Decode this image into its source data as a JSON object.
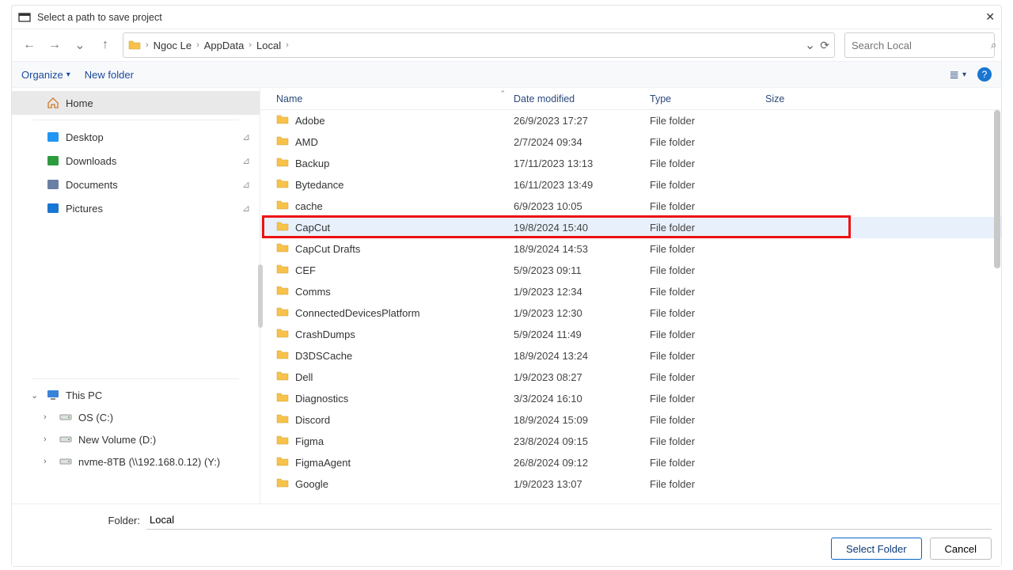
{
  "dialog": {
    "title": "Select a path to save project",
    "close_glyph": "✕"
  },
  "nav": {
    "back_glyph": "←",
    "forward_glyph": "→",
    "recent_glyph": "⌄",
    "up_glyph": "↑",
    "dropdown_glyph": "⌄",
    "refresh_glyph": "⟳"
  },
  "breadcrumbs": [
    {
      "label": "Ngoc Le"
    },
    {
      "label": "AppData"
    },
    {
      "label": "Local"
    }
  ],
  "search": {
    "placeholder": "Search Local",
    "glyph": "⌕"
  },
  "toolbar": {
    "organize": "Organize",
    "caret": "▾",
    "new_folder": "New folder",
    "view_glyph": "≣",
    "view_caret": "▾",
    "help_glyph": "?"
  },
  "sidebar": {
    "home": "Home",
    "quick": [
      {
        "name": "Desktop",
        "icon": "desktop",
        "color": "#2196f3"
      },
      {
        "name": "Downloads",
        "icon": "download",
        "color": "#2e9b3f"
      },
      {
        "name": "Documents",
        "icon": "document",
        "color": "#6b7fa3"
      },
      {
        "name": "Pictures",
        "icon": "picture",
        "color": "#1976d2"
      }
    ],
    "tree": {
      "this_pc": "This PC",
      "drives": [
        "OS (C:)",
        "New Volume (D:)",
        "nvme-8TB (\\\\192.168.0.12) (Y:)"
      ]
    }
  },
  "columns": {
    "name": "Name",
    "date": "Date modified",
    "type": "Type",
    "size": "Size"
  },
  "files": [
    {
      "name": "Adobe",
      "date": "26/9/2023 17:27",
      "type": "File folder"
    },
    {
      "name": "AMD",
      "date": "2/7/2024 09:34",
      "type": "File folder"
    },
    {
      "name": "Backup",
      "date": "17/11/2023 13:13",
      "type": "File folder"
    },
    {
      "name": "Bytedance",
      "date": "16/11/2023 13:49",
      "type": "File folder"
    },
    {
      "name": "cache",
      "date": "6/9/2023 10:05",
      "type": "File folder"
    },
    {
      "name": "CapCut",
      "date": "19/8/2024 15:40",
      "type": "File folder",
      "highlighted": true
    },
    {
      "name": "CapCut Drafts",
      "date": "18/9/2024 14:53",
      "type": "File folder"
    },
    {
      "name": "CEF",
      "date": "5/9/2023 09:11",
      "type": "File folder"
    },
    {
      "name": "Comms",
      "date": "1/9/2023 12:34",
      "type": "File folder"
    },
    {
      "name": "ConnectedDevicesPlatform",
      "date": "1/9/2023 12:30",
      "type": "File folder"
    },
    {
      "name": "CrashDumps",
      "date": "5/9/2024 11:49",
      "type": "File folder"
    },
    {
      "name": "D3DSCache",
      "date": "18/9/2024 13:24",
      "type": "File folder"
    },
    {
      "name": "Dell",
      "date": "1/9/2023 08:27",
      "type": "File folder"
    },
    {
      "name": "Diagnostics",
      "date": "3/3/2024 16:10",
      "type": "File folder"
    },
    {
      "name": "Discord",
      "date": "18/9/2024 15:09",
      "type": "File folder"
    },
    {
      "name": "Figma",
      "date": "23/8/2024 09:15",
      "type": "File folder"
    },
    {
      "name": "FigmaAgent",
      "date": "26/8/2024 09:12",
      "type": "File folder"
    },
    {
      "name": "Google",
      "date": "1/9/2023 13:07",
      "type": "File folder"
    }
  ],
  "footer": {
    "folder_label": "Folder:",
    "folder_value": "Local",
    "select_btn": "Select Folder",
    "cancel_btn": "Cancel"
  },
  "annotation": {
    "highlight_index": 5
  }
}
